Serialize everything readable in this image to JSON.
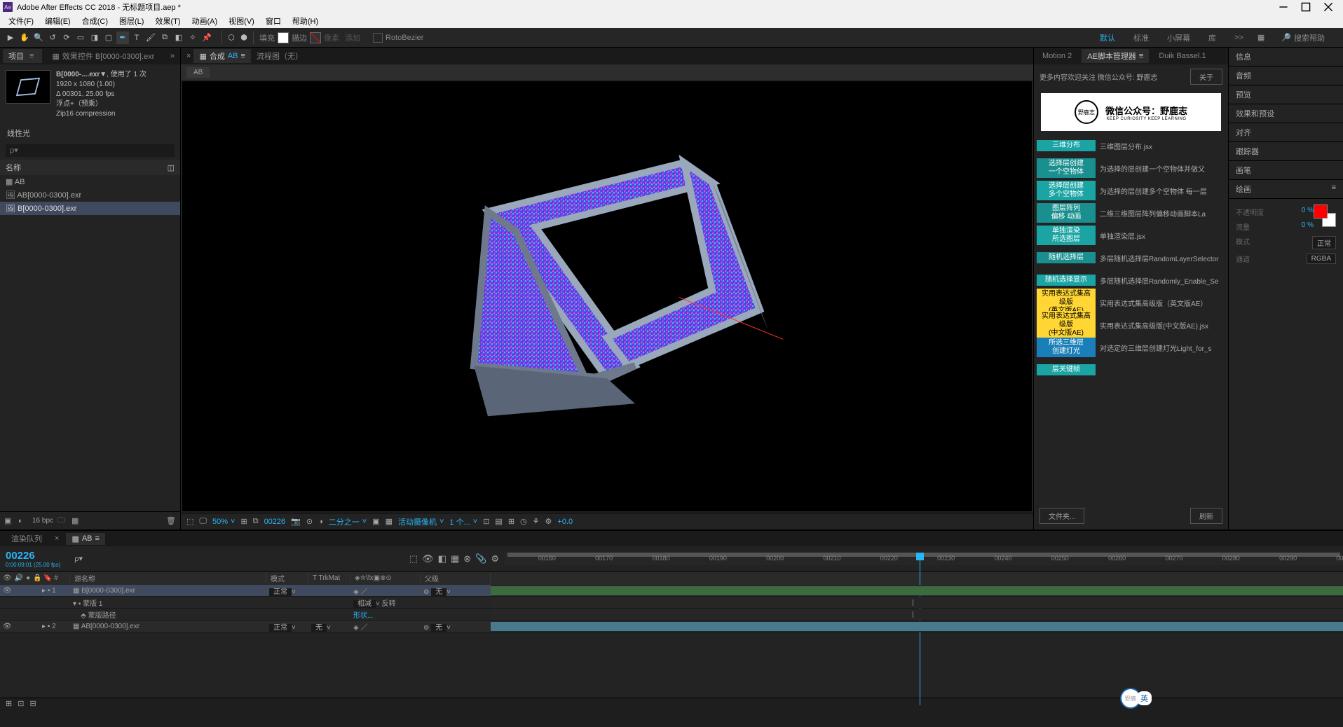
{
  "titlebar": {
    "app_logo": "Ae",
    "title": "Adobe After Effects CC 2018 - 无标题项目.aep *"
  },
  "menus": [
    "文件(F)",
    "编辑(E)",
    "合成(C)",
    "图层(L)",
    "效果(T)",
    "动画(A)",
    "视图(V)",
    "窗口",
    "帮助(H)"
  ],
  "toolbar": {
    "fill_label": "填充",
    "stroke_label": "描边",
    "px_label": "像素",
    "add_label": "添加",
    "rotobezier": "RotoBezier"
  },
  "workspaces": {
    "items": [
      "默认",
      "标准",
      "小屏幕",
      "库"
    ],
    "search_placeholder": "搜索帮助",
    "more": ">>"
  },
  "project": {
    "tab_project": "项目",
    "tab_effects": "效果控件 B[0000-0300].exr",
    "meta_name": "B[0000-....exr▼",
    "meta_used": ", 使用了 1 次",
    "meta_res": "1920 x 1080 (1.00)",
    "meta_dur": "Δ 00301, 25.00 fps",
    "meta_float": "浮点+（预乘）",
    "meta_comp": "Zip16 compression",
    "effect_name": "线性光",
    "col_name": "名称",
    "items": [
      {
        "name": "AB",
        "type": "comp"
      },
      {
        "name": "AB[0000-0300].exr",
        "type": "seq"
      },
      {
        "name": "B[0000-0300].exr",
        "type": "seq",
        "selected": true
      }
    ],
    "bpc": "16 bpc"
  },
  "comp": {
    "tab_comp_prefix": "合成",
    "tab_comp_name": "AB",
    "tab_flow": "流程图（无）",
    "subtab": "AB",
    "zoom": "50%",
    "frame": "00226",
    "res": "二分之一",
    "camera": "活动摄像机",
    "views": "1 个...",
    "exposure": "+0.0"
  },
  "scripts": {
    "tab_motion": "Motion 2",
    "tab_manager": "AE脚本管理器",
    "tab_duik": "Duik Bassel.1",
    "notice": "更多内容欢迎关注 微信公众号: 野鹿志",
    "about_btn": "关于",
    "wechat_title": "微信公众号：野鹿志",
    "wechat_sub": "KEEP CURIOSITY KEEP LEARNING",
    "list": [
      {
        "label": "三维分布",
        "desc": "三维图层分布.jsx",
        "color": "teal"
      },
      {
        "label": "选择层创建\n一个空物体",
        "desc": "为选择的层创建一个空物体并做父",
        "color": "teal-dk"
      },
      {
        "label": "选择层创建\n多个空物体",
        "desc": "为选择的层创建多个空物体 每一层",
        "color": "teal"
      },
      {
        "label": "图层阵列\n偏移 动画",
        "desc": "二维三维图层阵列偏移动画脚本La",
        "color": "teal-dk"
      },
      {
        "label": "单独渲染\n所选图层",
        "desc": "单独渲染层.jsx",
        "color": "teal"
      },
      {
        "label": "随机选择层",
        "desc": "多层随机选择层RandomLayerSelector",
        "color": "teal-dk"
      },
      {
        "label": "随机选择显示",
        "desc": "多层随机选择层Randomly_Enable_Se",
        "color": "teal"
      },
      {
        "label": "实用表达式集高级版\n(英文版AE)",
        "desc": "实用表达式集高级版（英文版AE）",
        "color": "yellow"
      },
      {
        "label": "实用表达式集高级版\n(中文版AE)",
        "desc": "实用表达式集高级版(中文版AE).jsx",
        "color": "yellow"
      },
      {
        "label": "所选三维层\n创建灯光",
        "desc": "对选定的三维层创建灯光Light_for_s",
        "color": "blue"
      },
      {
        "label": "层关键帧",
        "desc": "",
        "color": "teal"
      }
    ],
    "btn_folder": "文件夹...",
    "btn_refresh": "刷新"
  },
  "right_dock": {
    "tabs": [
      "信息",
      "音频",
      "预览",
      "效果和预设",
      "对齐",
      "跟踪器",
      "画笔",
      "绘画"
    ],
    "paint": {
      "opacity_lbl": "不透明度",
      "opacity_val": "0 %",
      "flow_lbl": "流量",
      "flow_val": "0 %",
      "mode_lbl": "模式",
      "mode_val": "正常",
      "channel_lbl": "通道",
      "channel_val": "RGBA"
    }
  },
  "timeline": {
    "tab_render": "渲染队列",
    "tab_comp": "AB",
    "timecode": "00226",
    "timecode_sub": "0:00:09:01 (25.00 fps)",
    "col_source": "源名称",
    "col_mode": "模式",
    "col_trk": "T  TrkMat",
    "col_parent": "父级",
    "mode_normal": "正常",
    "mode_add": "相减",
    "none": "无",
    "invert": "反转",
    "mask_label": "蒙版 1",
    "mask_path": "蒙版路径",
    "shape_val": "形状...",
    "layers": [
      {
        "num": "1",
        "name": "B[0000-0300].exr",
        "selected": true
      },
      {
        "num": "2",
        "name": "AB[0000-0300].exr"
      }
    ],
    "ruler_ticks": [
      "00160",
      "00170",
      "00180",
      "00190",
      "00200",
      "00210",
      "00220",
      "00230",
      "00240",
      "00250",
      "00260",
      "00270",
      "00280",
      "00290",
      "00"
    ]
  },
  "badge": {
    "lang": "英"
  }
}
